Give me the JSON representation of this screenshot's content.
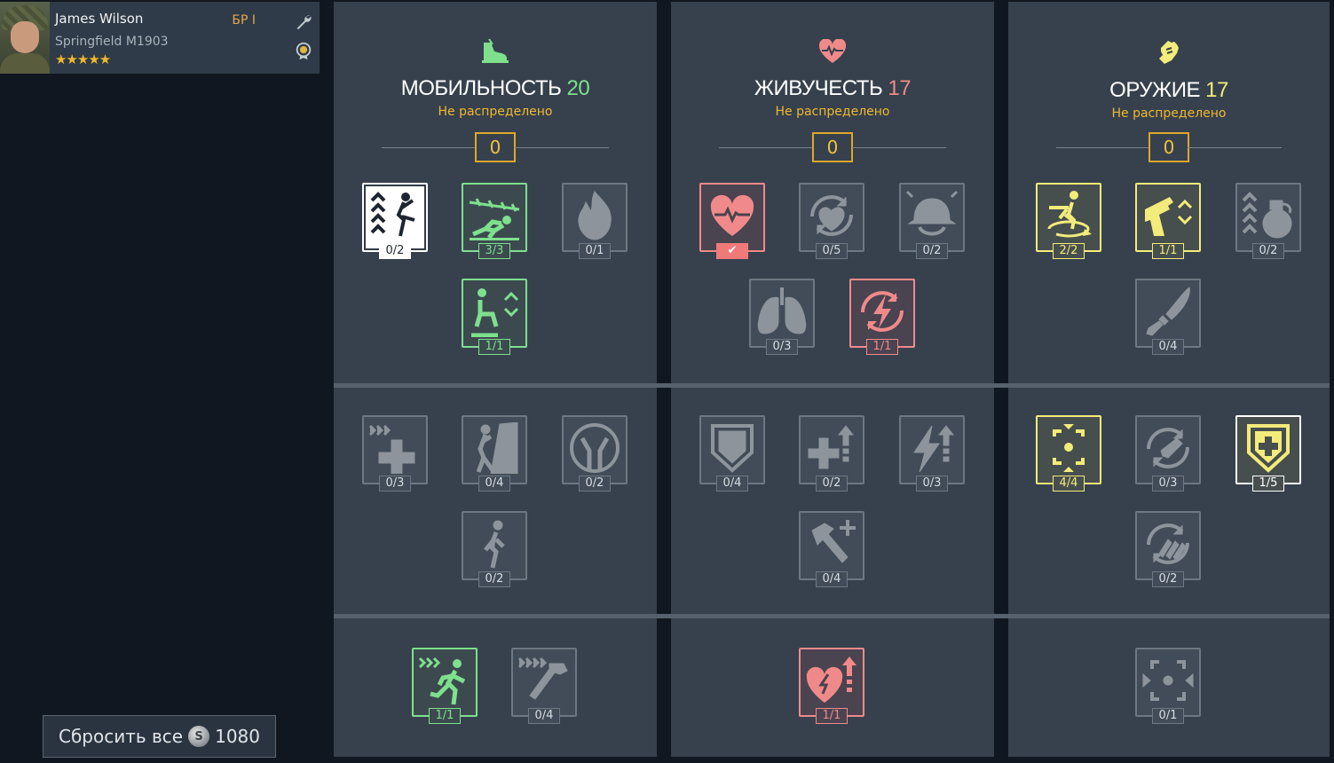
{
  "soldier": {
    "name": "James Wilson",
    "weapon": "Springfield M1903",
    "stars": "★★★★★",
    "br": "БР I"
  },
  "reset": {
    "label": "Сбросить все",
    "cost": "1080",
    "coin_symbol": "S"
  },
  "colors": {
    "mobility": "#7ee08d",
    "vitality": "#f08a8a",
    "weapons": "#f3ec7a",
    "unallocated": "#f0b830"
  },
  "categories": [
    {
      "title": "МОБИЛЬНОСТЬ",
      "points": "20",
      "subtitle": "Не распределено",
      "unallocated": "0",
      "icon": "running-shoe-icon"
    },
    {
      "title": "ЖИВУЧЕСТЬ",
      "points": "17",
      "subtitle": "Не распределено",
      "unallocated": "0",
      "icon": "heart-pulse-icon"
    },
    {
      "title": "ОРУЖИЕ",
      "points": "17",
      "subtitle": "Не распределено",
      "unallocated": "0",
      "icon": "fist-icon"
    }
  ],
  "skills": {
    "mobility": [
      {
        "icon": "vault-jump-icon",
        "count": "0/2"
      },
      {
        "icon": "crawl-under-wire-icon",
        "count": "3/3"
      },
      {
        "icon": "fire-resist-icon",
        "count": "0/1"
      },
      {
        "icon": "crouch-stance-icon",
        "count": "1/1"
      },
      {
        "icon": "fast-heal-icon",
        "count": "0/3"
      },
      {
        "icon": "climb-icon",
        "count": "0/4"
      },
      {
        "icon": "fall-resist-icon",
        "count": "0/2"
      },
      {
        "icon": "walk-icon",
        "count": "0/2"
      },
      {
        "icon": "sprint-icon",
        "count": "1/1"
      },
      {
        "icon": "fast-build-icon",
        "count": "0/4"
      }
    ],
    "vitality": [
      {
        "icon": "heart-icon",
        "count": "✔"
      },
      {
        "icon": "stamina-regen-icon",
        "count": "0/5"
      },
      {
        "icon": "helmet-icon",
        "count": "0/2"
      },
      {
        "icon": "lungs-icon",
        "count": "0/3"
      },
      {
        "icon": "energy-regen-icon",
        "count": "1/1"
      },
      {
        "icon": "armor-shield-icon",
        "count": "0/4"
      },
      {
        "icon": "heal-up-icon",
        "count": "0/2"
      },
      {
        "icon": "energy-up-icon",
        "count": "0/3"
      },
      {
        "icon": "repair-hammer-icon",
        "count": "0/4"
      },
      {
        "icon": "heart-boost-icon",
        "count": "1/1"
      }
    ],
    "weapons": [
      {
        "icon": "turn-aim-icon",
        "count": "2/2"
      },
      {
        "icon": "pistol-swap-icon",
        "count": "1/1"
      },
      {
        "icon": "grenade-throw-icon",
        "count": "0/2"
      },
      {
        "icon": "knife-icon",
        "count": "0/4"
      },
      {
        "icon": "aim-focus-icon",
        "count": "4/4"
      },
      {
        "icon": "reload-icon",
        "count": "0/3"
      },
      {
        "icon": "medkit-shield-icon",
        "count": "1/5"
      },
      {
        "icon": "ammo-refill-icon",
        "count": "0/2"
      },
      {
        "icon": "scope-icon",
        "count": "0/1"
      }
    ]
  }
}
